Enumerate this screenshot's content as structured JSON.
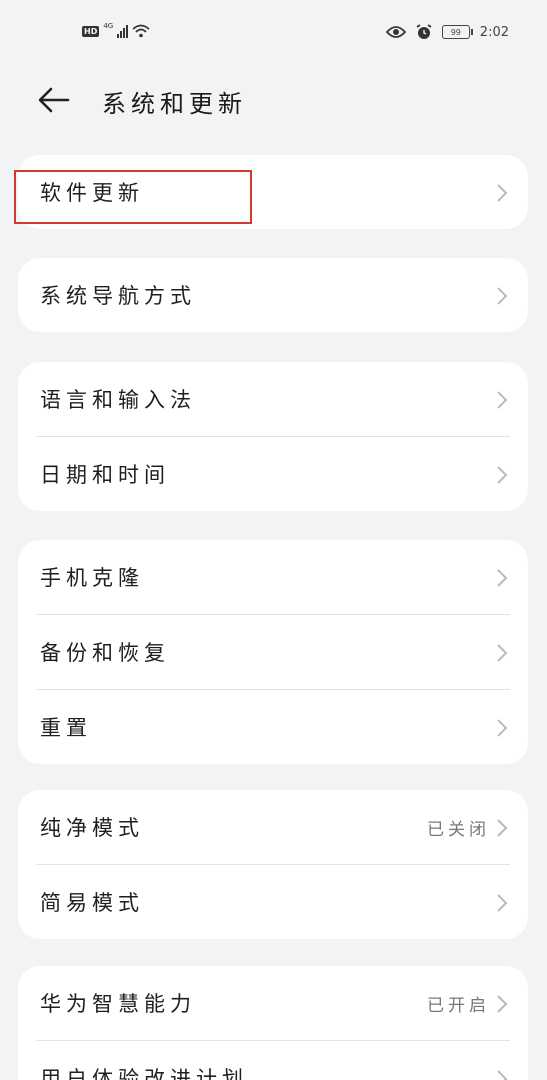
{
  "status_bar": {
    "hd": "HD",
    "network": "4G",
    "battery": "99",
    "time": "2:02",
    "icons": [
      "signal-icon",
      "wifi-icon",
      "eye-icon",
      "alarm-icon",
      "battery-icon"
    ]
  },
  "header": {
    "title": "系统和更新",
    "back_icon": "arrow-left-icon"
  },
  "groups": [
    {
      "items": [
        {
          "label": "软件更新"
        }
      ]
    },
    {
      "items": [
        {
          "label": "系统导航方式"
        }
      ]
    },
    {
      "items": [
        {
          "label": "语言和输入法"
        },
        {
          "label": "日期和时间"
        }
      ]
    },
    {
      "items": [
        {
          "label": "手机克隆"
        },
        {
          "label": "备份和恢复"
        },
        {
          "label": "重置"
        }
      ]
    },
    {
      "items": [
        {
          "label": "纯净模式",
          "value": "已关闭"
        },
        {
          "label": "简易模式"
        }
      ]
    },
    {
      "items": [
        {
          "label": "华为智慧能力",
          "value": "已开启"
        },
        {
          "label": "用户体验改进计划"
        }
      ]
    }
  ],
  "colors": {
    "background": "#f1f3f5",
    "card": "#ffffff",
    "highlight_border": "#d03a30"
  }
}
